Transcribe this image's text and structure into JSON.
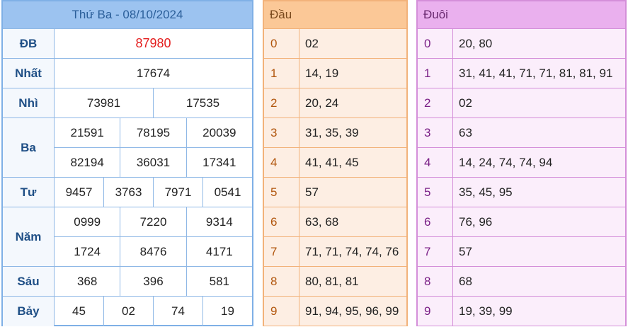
{
  "results": {
    "title": "Thứ Ba - 08/10/2024",
    "rows": [
      {
        "label": "ĐB",
        "lines": [
          [
            "87980"
          ]
        ]
      },
      {
        "label": "Nhất",
        "lines": [
          [
            "17674"
          ]
        ]
      },
      {
        "label": "Nhì",
        "lines": [
          [
            "73981",
            "17535"
          ]
        ]
      },
      {
        "label": "Ba",
        "lines": [
          [
            "21591",
            "78195",
            "20039"
          ],
          [
            "82194",
            "36031",
            "17341"
          ]
        ]
      },
      {
        "label": "Tư",
        "lines": [
          [
            "9457",
            "3763",
            "7971",
            "0541"
          ]
        ]
      },
      {
        "label": "Năm",
        "lines": [
          [
            "0999",
            "7220",
            "9314"
          ],
          [
            "1724",
            "8476",
            "4171"
          ]
        ]
      },
      {
        "label": "Sáu",
        "lines": [
          [
            "368",
            "396",
            "581"
          ]
        ]
      },
      {
        "label": "Bảy",
        "lines": [
          [
            "45",
            "02",
            "74",
            "19"
          ]
        ]
      }
    ]
  },
  "dau": {
    "title": "Đầu",
    "rows": [
      {
        "digit": "0",
        "values": "02"
      },
      {
        "digit": "1",
        "values": "14, 19"
      },
      {
        "digit": "2",
        "values": "20, 24"
      },
      {
        "digit": "3",
        "values": "31, 35, 39"
      },
      {
        "digit": "4",
        "values": "41, 41, 45"
      },
      {
        "digit": "5",
        "values": "57"
      },
      {
        "digit": "6",
        "values": "63, 68"
      },
      {
        "digit": "7",
        "values": "71, 71, 74, 74, 76"
      },
      {
        "digit": "8",
        "values": "80, 81, 81"
      },
      {
        "digit": "9",
        "values": "91, 94, 95, 96, 99"
      }
    ]
  },
  "duoi": {
    "title": "Đuôi",
    "rows": [
      {
        "digit": "0",
        "values": "20, 80"
      },
      {
        "digit": "1",
        "values": "31, 41, 41, 71, 71, 81, 81, 91"
      },
      {
        "digit": "2",
        "values": "02"
      },
      {
        "digit": "3",
        "values": "63"
      },
      {
        "digit": "4",
        "values": "14, 24, 74, 74, 94"
      },
      {
        "digit": "5",
        "values": "35, 45, 95"
      },
      {
        "digit": "6",
        "values": "76, 96"
      },
      {
        "digit": "7",
        "values": "57"
      },
      {
        "digit": "8",
        "values": "68"
      },
      {
        "digit": "9",
        "values": "19, 39, 99"
      }
    ]
  },
  "colors": {
    "special_prize": "#e41e1e",
    "results_header": "#9cc3f0",
    "dau_header": "#fbc897",
    "duoi_header": "#eab0ee"
  }
}
